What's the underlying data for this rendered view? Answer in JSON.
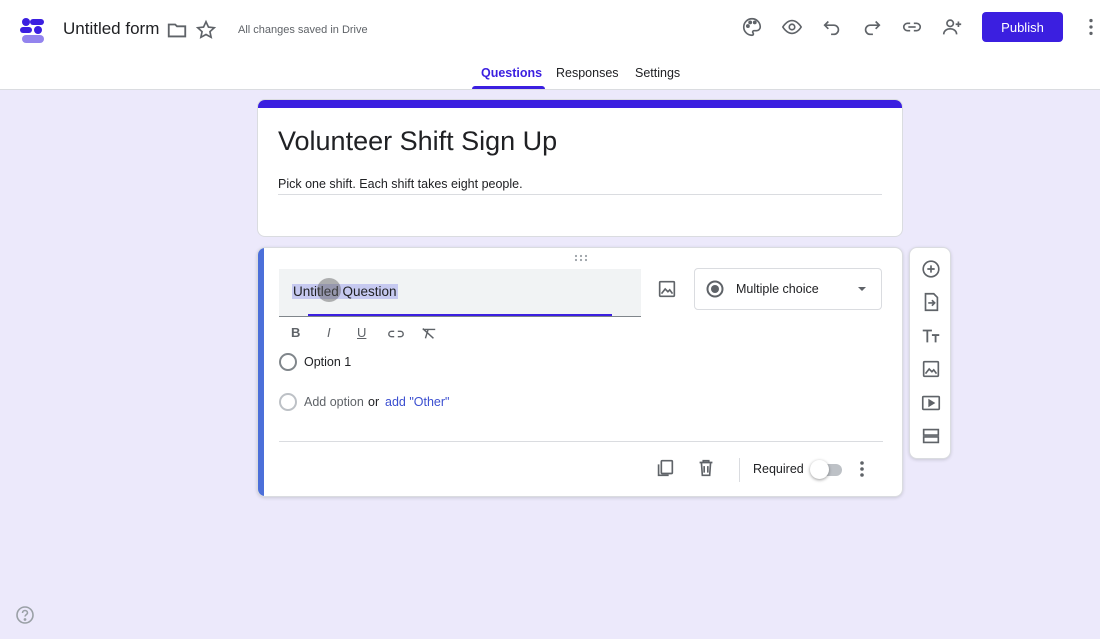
{
  "header": {
    "doc_title": "Untitled form",
    "saved_status": "All changes saved in Drive",
    "publish_label": "Publish",
    "icons": [
      "forms-logo-icon",
      "folder-icon",
      "star-icon",
      "palette-icon",
      "eye-icon",
      "undo-icon",
      "redo-icon",
      "link-icon",
      "add-person-icon",
      "more-vert-icon"
    ]
  },
  "tabs": [
    {
      "label": "Questions",
      "active": true
    },
    {
      "label": "Responses",
      "active": false
    },
    {
      "label": "Settings",
      "active": false
    }
  ],
  "form": {
    "title": "Volunteer Shift Sign Up",
    "description": "Pick one shift. Each shift takes eight people.",
    "accent_color": "#3b1fe0"
  },
  "question": {
    "text": "Untitled Question",
    "type_label": "Multiple choice",
    "format_buttons": [
      "B",
      "I",
      "U"
    ],
    "options": [
      "Option 1"
    ],
    "add_option_label": "Add option",
    "or_label": "or",
    "add_other_label": "add \"Other\"",
    "required_label": "Required",
    "required": false
  },
  "side_toolbar": [
    "add-question-icon",
    "import-questions-icon",
    "add-title-icon",
    "add-image-icon",
    "add-video-icon",
    "add-section-icon"
  ]
}
